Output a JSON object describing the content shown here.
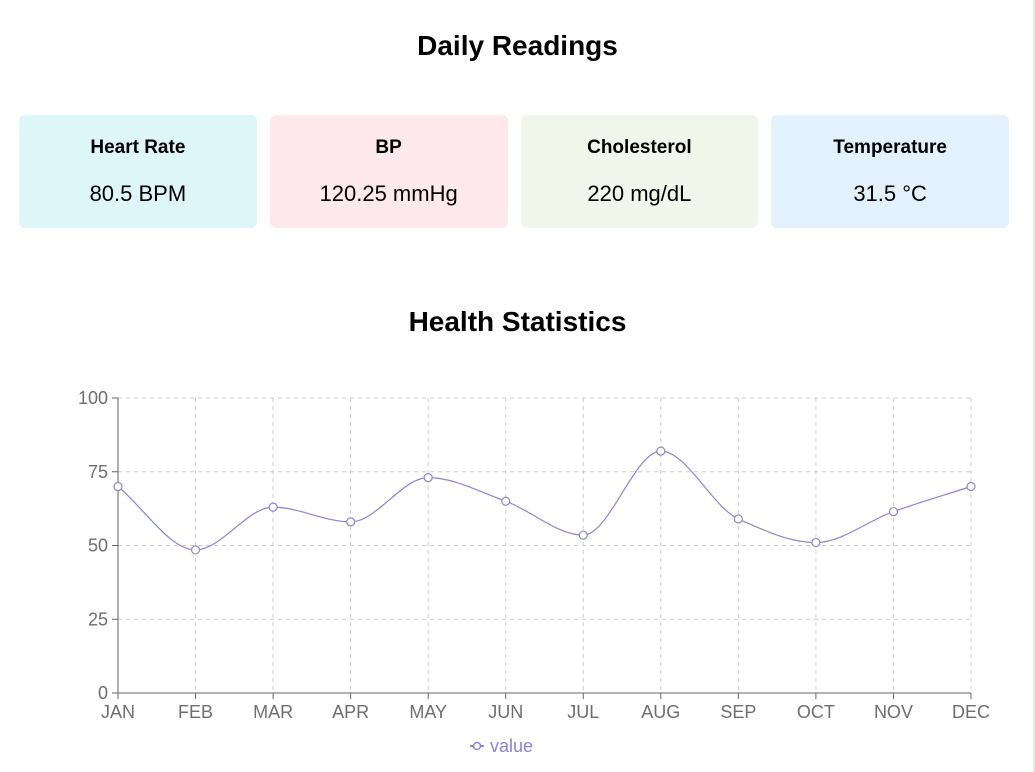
{
  "header": {
    "title": "Daily Readings"
  },
  "cards": [
    {
      "label": "Heart Rate",
      "value": "80.5 BPM",
      "color": "#dff6f8"
    },
    {
      "label": "BP",
      "value": "120.25 mmHg",
      "color": "#fde9ec"
    },
    {
      "label": "Cholesterol",
      "value": "220 mg/dL",
      "color": "#f1f6ea"
    },
    {
      "label": "Temperature",
      "value": "31.5 °C",
      "color": "#e3f1fd"
    }
  ],
  "chart_data": {
    "type": "line",
    "title": "Health Statistics",
    "categories": [
      "JAN",
      "FEB",
      "MAR",
      "APR",
      "MAY",
      "JUN",
      "JUL",
      "AUG",
      "SEP",
      "OCT",
      "NOV",
      "DEC"
    ],
    "series": [
      {
        "name": "value",
        "values": [
          70,
          48.5,
          63,
          58,
          73,
          65,
          53.5,
          82,
          59,
          51,
          61.5,
          70
        ],
        "color": "#8884d8"
      }
    ],
    "ylim": [
      0,
      100
    ],
    "yticks": [
      0,
      25,
      50,
      75,
      100
    ],
    "xlabel": "",
    "ylabel": "",
    "grid": true,
    "legend": "bottom-center",
    "curve": "smooth"
  }
}
